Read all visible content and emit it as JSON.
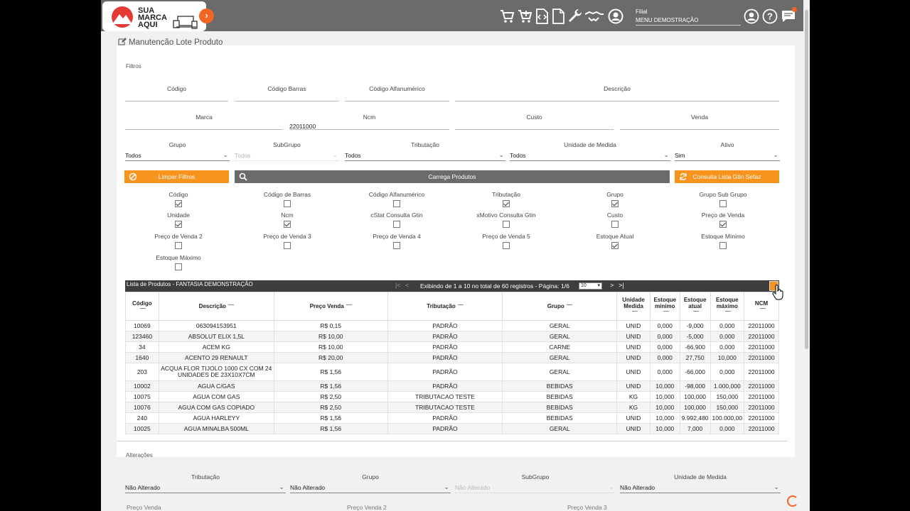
{
  "header": {
    "logo_lines": [
      "SUA",
      "MARCA",
      "AQUI"
    ],
    "filial_label": "Filial",
    "filial_value": "MENU DEMOSTRAÇÃO",
    "accent": "#f26522",
    "toolbar_icons": [
      "cart-icon",
      "cart-plus-icon",
      "code-file-icon",
      "file-icon",
      "wrench-icon",
      "handshake-icon",
      "user-circle-icon"
    ],
    "right_icons": [
      "account-icon",
      "help-icon",
      "chat-icon"
    ]
  },
  "page": {
    "title": "Manutenção Lote Produto"
  },
  "filters": {
    "section_label": "Filtros",
    "fields_row1": [
      {
        "label": "Código",
        "value": ""
      },
      {
        "label": "Código Barras",
        "value": ""
      },
      {
        "label": "Código Alfanumérico",
        "value": ""
      },
      {
        "label": "Descrição",
        "value": ""
      }
    ],
    "fields_row2": [
      {
        "label": "Marca",
        "value": ""
      },
      {
        "label": "Ncm",
        "value": "22011000"
      },
      {
        "label": "Custo",
        "value": ""
      },
      {
        "label": "Venda",
        "value": ""
      }
    ],
    "selects": [
      {
        "label": "Grupo",
        "value": "Todos"
      },
      {
        "label": "SubGrupo",
        "value": "Todos"
      },
      {
        "label": "Tributação",
        "value": "Todos"
      },
      {
        "label": "Unidade de Medida",
        "value": "Todos"
      },
      {
        "label": "Ativo",
        "value": "Sim"
      }
    ],
    "buttons": {
      "clear": "Limpar Filtros",
      "load": "Carrega Produtos",
      "gtin": "Consulta Lista Gtin Sefaz"
    }
  },
  "columns_chooser": [
    {
      "label": "Código",
      "checked": true
    },
    {
      "label": "Código de Barras",
      "checked": false
    },
    {
      "label": "Código Alfanumérico",
      "checked": false
    },
    {
      "label": "Tributação",
      "checked": true
    },
    {
      "label": "Grupo",
      "checked": true
    },
    {
      "label": "Grupo Sub Grupo",
      "checked": false
    },
    {
      "label": "Unidade",
      "checked": true
    },
    {
      "label": "Ncm",
      "checked": true
    },
    {
      "label": "cStat Consulta Gtin",
      "checked": false
    },
    {
      "label": "xMotivo Consulta Gtin",
      "checked": false
    },
    {
      "label": "Custo",
      "checked": false
    },
    {
      "label": "Preço de Venda",
      "checked": true
    },
    {
      "label": "Preço de Venda 2",
      "checked": false
    },
    {
      "label": "Preço de Venda 3",
      "checked": false
    },
    {
      "label": "Preço de Venda 4",
      "checked": false
    },
    {
      "label": "Preço de Venda 5",
      "checked": false
    },
    {
      "label": "Estoque Atual",
      "checked": true
    },
    {
      "label": "Estoque Mínimo",
      "checked": false
    },
    {
      "label": "Estoque Máximo",
      "checked": false
    }
  ],
  "grid": {
    "title": "Lista de Produtos - FANTASIA DEMONSTRAÇÃO",
    "pager_text": "Exibindo de 1 a 10 no total de 60 registros - Página: 1/6",
    "page_size": "10",
    "headers": [
      "Código",
      "Descrição",
      "Preço Venda",
      "Tributação",
      "Grupo",
      "Unidade Medida",
      "Estoque mínimo",
      "Estoque atual",
      "Estoque máximo",
      "NCM"
    ],
    "rows": [
      [
        "10069",
        "063094153951",
        "R$ 0,15",
        "PADRÃO",
        "GERAL",
        "UNID",
        "0,000",
        "-9,000",
        "0,000",
        "22011000"
      ],
      [
        "123460",
        "ABSOLUT ELIX 1,5L",
        "R$ 10,00",
        "PADRÃO",
        "GERAL",
        "UNID",
        "0,000",
        "-5,000",
        "0,000",
        "22011000"
      ],
      [
        "34",
        "ACEM KG",
        "R$ 10,00",
        "PADRÃO",
        "CARNE",
        "UNID",
        "0,000",
        "-66,900",
        "0,000",
        "22011000"
      ],
      [
        "1640",
        "ACENTO 29 RENAULT",
        "R$ 20,00",
        "PADRÃO",
        "GERAL",
        "UNID",
        "0,000",
        "27,750",
        "10,000",
        "22011000"
      ],
      [
        "203",
        "ACQUA FLOR TIJOLO 1000 CX COM 24 UNIDADES DE 23X10X7CM",
        "R$ 1,56",
        "PADRÃO",
        "GERAL",
        "UNID",
        "0,000",
        "-66,000",
        "0,000",
        "22011000"
      ],
      [
        "10002",
        "AGUA C/GAS",
        "R$ 1,56",
        "PADRÃO",
        "BEBIDAS",
        "UNID",
        "10,000",
        "-98,000",
        "1.000,000",
        "22011000"
      ],
      [
        "10075",
        "AGUA COM GAS",
        "R$ 2,50",
        "TRIBUTACAO TESTE",
        "BEBIDAS",
        "KG",
        "10,000",
        "100,000",
        "150,000",
        "22011000"
      ],
      [
        "10076",
        "AGUA COM GAS COPIADO",
        "R$ 2,50",
        "TRIBUTACAO TESTE",
        "BEBIDAS",
        "KG",
        "10,000",
        "100,000",
        "150,000",
        "22011000"
      ],
      [
        "240",
        "AGUA HARLEYY",
        "R$ 1,56",
        "PADRÃO",
        "BEBIDAS",
        "UNID",
        "10,000",
        "9.992,480",
        "100.000,00",
        "22011000"
      ],
      [
        "10025",
        "AGUA MINALBA 500ML",
        "R$ 1,56",
        "PADRÃO",
        "GERAL",
        "UNID",
        "10,000",
        "7,000",
        "0,000",
        "22011000"
      ]
    ]
  },
  "changes": {
    "section_label": "Alterações",
    "selects": [
      {
        "label": "Tributação",
        "value": "Não Alterado"
      },
      {
        "label": "Grupo",
        "value": "Não Alterado"
      },
      {
        "label": "SubGrupo",
        "value": "Não Alterado"
      },
      {
        "label": "Unidade de Medida",
        "value": "Não Alterado"
      }
    ],
    "price_labels": [
      "Preço Venda",
      "Preço Venda 2",
      "Preço Venda 3"
    ]
  }
}
